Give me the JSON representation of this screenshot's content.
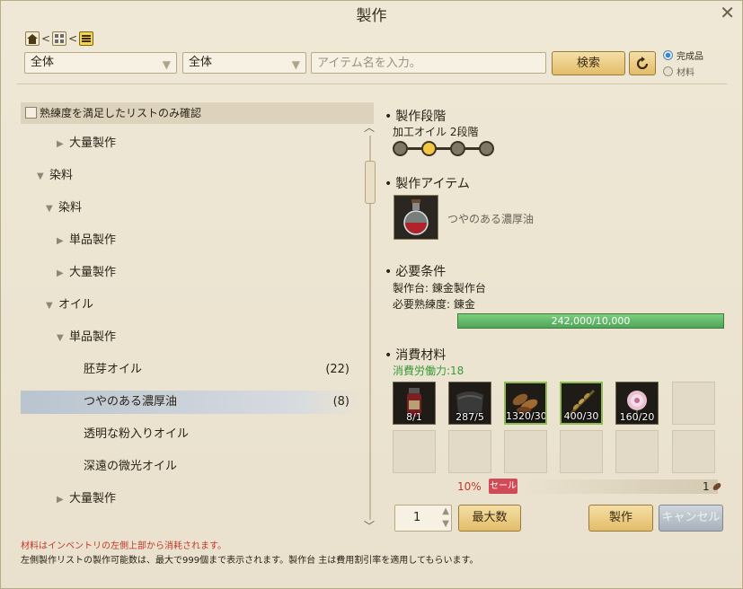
{
  "window": {
    "title": "製作",
    "close_glyph": "✕"
  },
  "breadcrumb": {
    "sep": "<"
  },
  "filters": {
    "category1": "全体",
    "category2": "全体",
    "search_placeholder": "アイテム名を入力。",
    "search_button": "検索",
    "mode_options": [
      {
        "label": "完成品",
        "selected": true
      },
      {
        "label": "材料",
        "selected": false
      }
    ]
  },
  "list": {
    "checkbox_label": "熟練度を満足したリストのみ確認",
    "items": [
      {
        "label": "大量製作",
        "expanded": false
      },
      {
        "label": "染料",
        "expanded": true
      },
      {
        "label": "染料",
        "expanded": true
      },
      {
        "label": "単品製作",
        "expanded": false
      },
      {
        "label": "大量製作",
        "expanded": false
      },
      {
        "label": "オイル",
        "expanded": true
      },
      {
        "label": "単品製作",
        "expanded": true
      },
      {
        "label": "胚芽オイル",
        "count": "(22)"
      },
      {
        "label": "つやのある濃厚油",
        "count": "(8)",
        "selected": true
      },
      {
        "label": "透明な粉入りオイル"
      },
      {
        "label": "深遠の微光オイル"
      },
      {
        "label": "大量製作",
        "expanded": false
      }
    ]
  },
  "detail": {
    "stage_heading": "製作段階",
    "stage_text": "加工オイル 2段階",
    "stage_level": 2,
    "stage_total": 4,
    "item_heading": "製作アイテム",
    "item_name": "つやのある濃厚油",
    "req_heading": "必要条件",
    "req_table": "製作台: 錬金製作台",
    "req_skill": "必要熟練度: 錬金",
    "skill_bar_text": "242,000/10,000",
    "skill_bar_fill": 1.0,
    "mat_heading": "消費材料",
    "labor": "消費労働力:18",
    "materials": [
      {
        "name": "potion-icon",
        "qty": "8/1",
        "ok": false
      },
      {
        "name": "cloth-icon",
        "qty": "287/5",
        "ok": false
      },
      {
        "name": "seed-icon",
        "qty": "1320/30",
        "ok": true
      },
      {
        "name": "grain-icon",
        "qty": "400/30",
        "ok": true
      },
      {
        "name": "flower-icon",
        "qty": "160/20",
        "ok": false
      }
    ],
    "discount": "10%",
    "sale_badge": "セール",
    "cost": "1",
    "quantity": "1",
    "max_button": "最大数",
    "craft_button": "製作",
    "cancel_button": "キャンセル"
  },
  "footer": {
    "warning": "材料はインベントリの左側上部から消耗されます。",
    "note": "左側製作リストの製作可能数は、最大で999個まで表示されます。製作台 主は費用割引率を適用してもらいます。"
  },
  "colors": {
    "accent_gold": "#e2bd6a",
    "bar_green": "#4ea55a",
    "labor_green": "#3a9a3a",
    "warning_red": "#c0392b",
    "sale_red": "#d04a58"
  }
}
